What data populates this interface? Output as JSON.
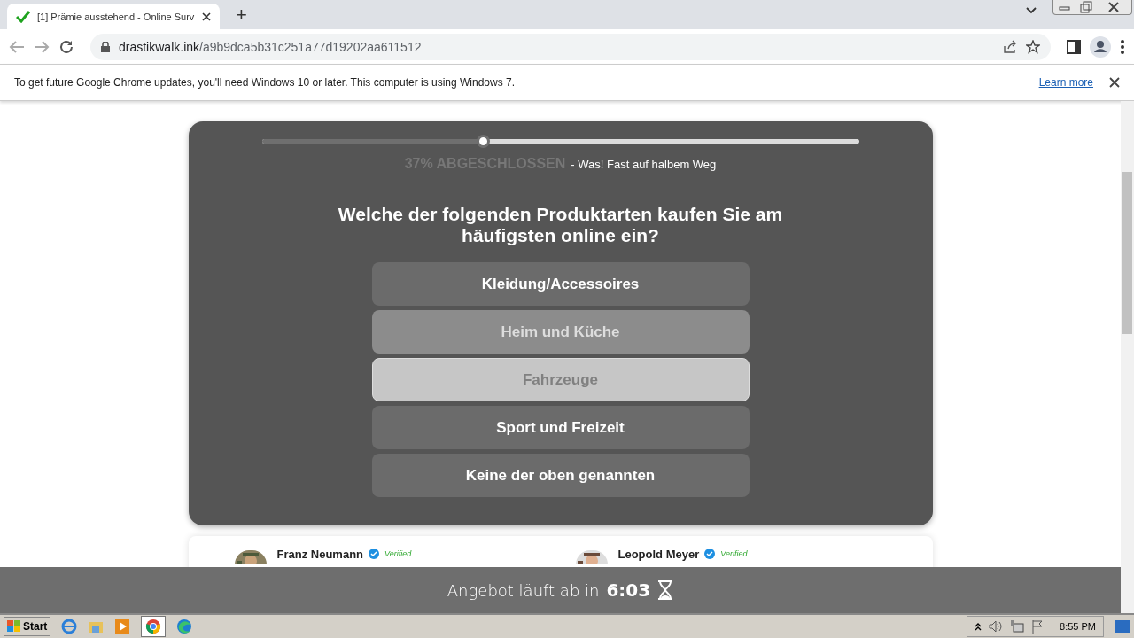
{
  "browser": {
    "tab": {
      "title": "[1] Prämie ausstehend - Online Surv",
      "selected": true
    },
    "new_tab": "+",
    "url_domain": "drastikwalk.ink",
    "url_path": "/a9b9dca5b31c251a77d19202aa611512"
  },
  "infobar": {
    "message": "To get future Google Chrome updates, you'll need Windows 10 or later. This computer is using Windows 7.",
    "link": "Learn more"
  },
  "survey": {
    "progress": {
      "level": 0.37,
      "label": "37% ABGESCHLOSSEN",
      "note": "- Was! Fast auf halbem Weg"
    },
    "question": "Welche der folgenden Produktarten kaufen Sie am häufigsten online ein?",
    "options": [
      {
        "label": "Kleidung/Accessoires",
        "kind": "normal"
      },
      {
        "label": "Heim und Küche",
        "kind": "faded"
      },
      {
        "label": "Fahrzeuge",
        "kind": "pale"
      },
      {
        "label": "Sport und Freizeit",
        "kind": "normal"
      },
      {
        "label": "Keine der oben genannten",
        "kind": "normal"
      }
    ]
  },
  "reviews": [
    {
      "name": "Franz Neumann",
      "badge": "Verified"
    },
    {
      "name": "Leopold Meyer",
      "badge": "Verified"
    }
  ],
  "timer": {
    "text": "Angebot läuft ab in",
    "time": "6:03"
  },
  "taskbar": {
    "start": "Start",
    "clock": "8:55 PM"
  }
}
